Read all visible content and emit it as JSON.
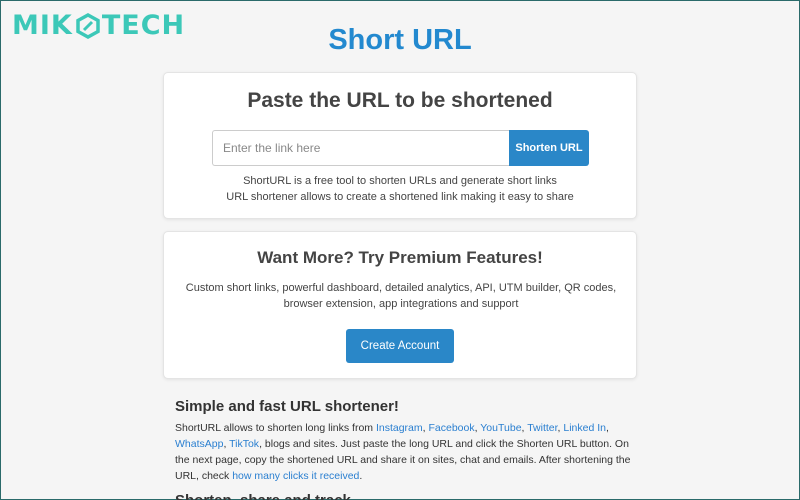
{
  "watermark": {
    "text_left": "MIK",
    "text_right": "TECH"
  },
  "page": {
    "title": "Short URL"
  },
  "shortener": {
    "heading": "Paste the URL to be shortened",
    "input_placeholder": "Enter the link here",
    "button_label": "Shorten URL",
    "desc_line1": "ShortURL is a free tool to shorten URLs and generate short links",
    "desc_line2": "URL shortener allows to create a shortened link making it easy to share"
  },
  "premium": {
    "heading": "Want More? Try Premium Features!",
    "desc_line1": "Custom short links, powerful dashboard, detailed analytics, API, UTM builder, QR codes,",
    "desc_line2": "browser extension, app integrations and support",
    "button_label": "Create Account"
  },
  "article": {
    "heading": "Simple and fast URL shortener!",
    "intro": "ShortURL allows to shorten long links from ",
    "links": {
      "instagram": "Instagram",
      "facebook": "Facebook",
      "youtube": "YouTube",
      "twitter": "Twitter",
      "linkedin": "Linked In",
      "whatsapp": "WhatsApp",
      "tiktok": "TikTok",
      "clicks": "how many clicks it received"
    },
    "sep1": ", ",
    "sep2": ", ",
    "sep3": ", ",
    "sep4": ", ",
    "sep5": ", ",
    "sep6": ", ",
    "mid_text": ", blogs and sites. Just paste the long URL and click the Shorten URL button. On the next page, copy the shortened URL and share it on sites, chat and emails. After shortening the URL, check ",
    "end_text": ".",
    "next_heading": "Shorten, share and track"
  },
  "colors": {
    "title_blue": "#2389cf",
    "button_blue": "#2a87c8",
    "link_blue": "#2a7fd0",
    "watermark_teal": "#3cc8b8"
  }
}
